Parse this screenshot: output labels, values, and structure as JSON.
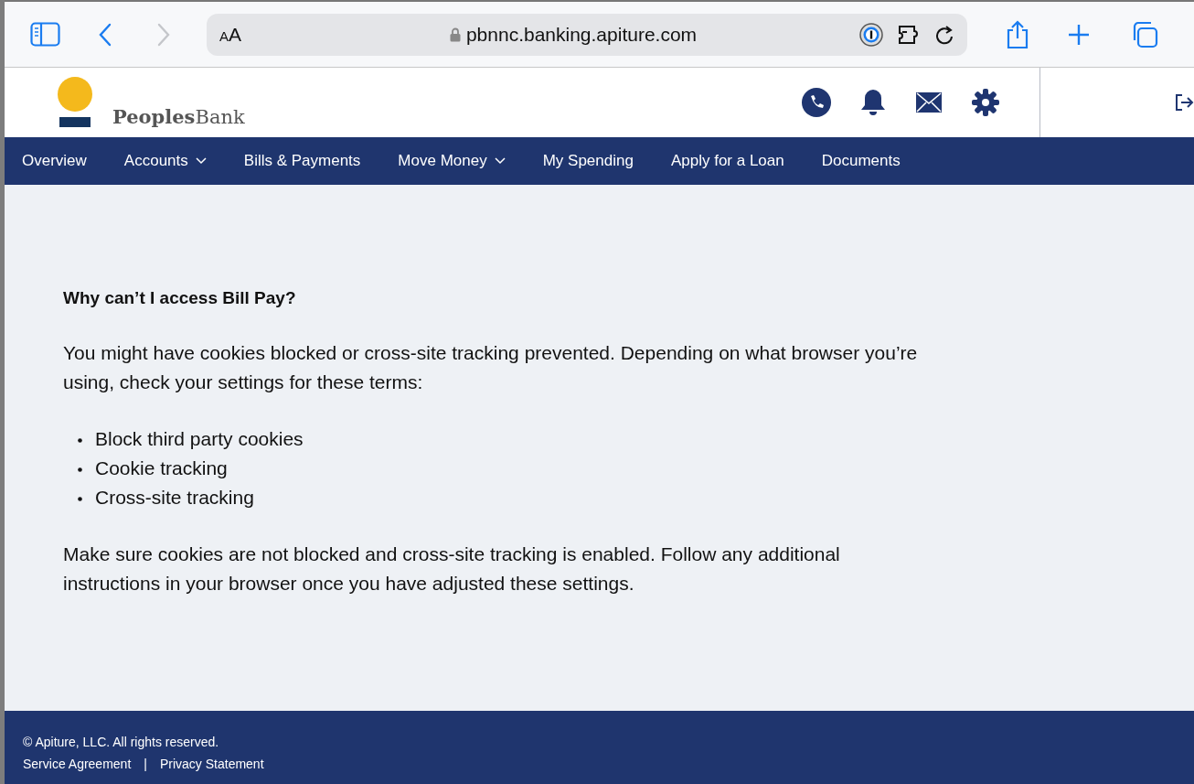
{
  "browser": {
    "text_size_button": "AA",
    "url": "pbnnc.banking.apiture.com"
  },
  "header": {
    "logo_bold": "Peoples",
    "logo_light": "Bank"
  },
  "nav": {
    "items": [
      {
        "label": "Overview",
        "dropdown": false
      },
      {
        "label": "Accounts",
        "dropdown": true
      },
      {
        "label": "Bills & Payments",
        "dropdown": false
      },
      {
        "label": "Move Money",
        "dropdown": true
      },
      {
        "label": "My Spending",
        "dropdown": false
      },
      {
        "label": "Apply for a Loan",
        "dropdown": false
      },
      {
        "label": "Documents",
        "dropdown": false
      }
    ]
  },
  "content": {
    "heading": "Why can’t I access Bill Pay?",
    "intro": "You might have cookies blocked or cross-site tracking prevented. Depending on what browser you’re using, check your settings for these terms:",
    "terms": [
      "Block third party cookies",
      "Cookie tracking",
      "Cross-site tracking"
    ],
    "outro": "Make sure cookies are not blocked and cross-site tracking is enabled. Follow any additional instructions in your browser once you have adjusted these settings."
  },
  "footer": {
    "copyright": "© Apiture, LLC. All rights reserved.",
    "links": [
      "Service Agreement",
      "Privacy Statement"
    ],
    "separator": "|"
  }
}
